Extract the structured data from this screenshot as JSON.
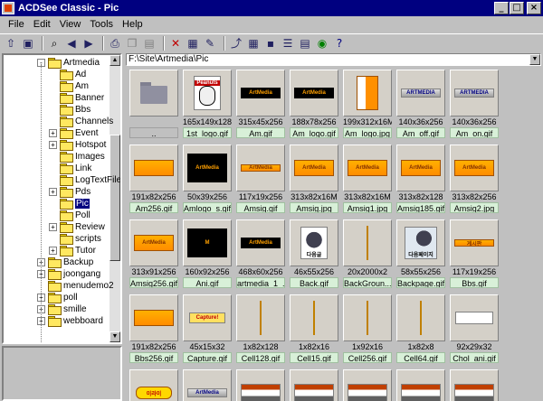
{
  "window": {
    "title": "ACDSee Classic - Pic"
  },
  "menu": [
    "File",
    "Edit",
    "View",
    "Tools",
    "Help"
  ],
  "menu_accel": [
    "F",
    "E",
    "V",
    "T",
    "H"
  ],
  "window_buttons": {
    "minimize": "_",
    "maximize": "□",
    "close": "×"
  },
  "toolbar_icons": [
    "browse-up-icon",
    "browse-folder-icon",
    "find-icon",
    "back-icon",
    "forward-icon",
    "print-icon",
    "copy-icon",
    "paste-icon",
    "delete-icon",
    "properties-icon",
    "edit-icon",
    "up-folder-icon",
    "view-large-icon",
    "view-small-icon",
    "view-list-icon",
    "view-details-icon",
    "slideshow-icon",
    "help-icon"
  ],
  "path": "F:\\Site\\Artmedia\\Pic",
  "tree": [
    {
      "label": "Artmedia",
      "level": 0,
      "expand": "-"
    },
    {
      "label": "Ad",
      "level": 1,
      "expand": ""
    },
    {
      "label": "Am",
      "level": 1,
      "expand": ""
    },
    {
      "label": "Banner",
      "level": 1,
      "expand": ""
    },
    {
      "label": "Bbs",
      "level": 1,
      "expand": ""
    },
    {
      "label": "Channels",
      "level": 1,
      "expand": ""
    },
    {
      "label": "Event",
      "level": 1,
      "expand": "+"
    },
    {
      "label": "Hotspot",
      "level": 1,
      "expand": "+"
    },
    {
      "label": "Images",
      "level": 1,
      "expand": ""
    },
    {
      "label": "Link",
      "level": 1,
      "expand": ""
    },
    {
      "label": "LogTextFile",
      "level": 1,
      "expand": ""
    },
    {
      "label": "Pds",
      "level": 1,
      "expand": "+"
    },
    {
      "label": "Pic",
      "level": 1,
      "expand": "",
      "selected": true
    },
    {
      "label": "Poll",
      "level": 1,
      "expand": ""
    },
    {
      "label": "Review",
      "level": 1,
      "expand": "+"
    },
    {
      "label": "scripts",
      "level": 1,
      "expand": ""
    },
    {
      "label": "Tutor",
      "level": 1,
      "expand": "+"
    },
    {
      "label": "Backup",
      "level": 0,
      "expand": "+"
    },
    {
      "label": "joongang",
      "level": 0,
      "expand": "+"
    },
    {
      "label": "menudemo2",
      "level": 0,
      "expand": ""
    },
    {
      "label": "poll",
      "level": 0,
      "expand": "+"
    },
    {
      "label": "smille",
      "level": 0,
      "expand": "+"
    },
    {
      "label": "webboard",
      "level": 0,
      "expand": "+"
    }
  ],
  "files": [
    {
      "dims": "",
      "name": "..",
      "kind": "folder"
    },
    {
      "dims": "165x149x128",
      "name": "1st_logo.gif",
      "kind": "peanuts",
      "text": "Peanuts"
    },
    {
      "dims": "315x45x256",
      "name": "Am.gif",
      "kind": "dark",
      "text": "ArtMedia"
    },
    {
      "dims": "188x78x256",
      "name": "Am_logo.gif",
      "kind": "dark",
      "text": "ArtMedia"
    },
    {
      "dims": "199x312x16M",
      "name": "Am_logo.jpg",
      "kind": "orange-tall",
      "text": ""
    },
    {
      "dims": "140x36x256",
      "name": "Am_off.gif",
      "kind": "silver",
      "text": "ARTMEDIA"
    },
    {
      "dims": "140x36x256",
      "name": "Am_on.gif",
      "kind": "silver",
      "text": "ARTMEDIA"
    },
    {
      "dims": "191x82x256",
      "name": "Am256.gif",
      "kind": "orange",
      "text": ""
    },
    {
      "dims": "50x39x256",
      "name": "Amlogo_s.gif",
      "kind": "dark-logo",
      "text": "ArtMedia"
    },
    {
      "dims": "117x19x256",
      "name": "Amsig.gif",
      "kind": "orange-slim",
      "text": "ArtMedia"
    },
    {
      "dims": "313x82x16M",
      "name": "Amsig.jpg",
      "kind": "orange",
      "text": "ArtMedia"
    },
    {
      "dims": "313x82x16M",
      "name": "Amsig1.jpg",
      "kind": "orange",
      "text": "ArtMedia"
    },
    {
      "dims": "313x82x128",
      "name": "Amsig185.gif",
      "kind": "orange",
      "text": "ArtMedia"
    },
    {
      "dims": "313x82x256",
      "name": "Amsig2.jpg",
      "kind": "orange",
      "text": "ArtMedia"
    },
    {
      "dims": "313x91x256",
      "name": "Amsig256.gif",
      "kind": "orange",
      "text": "ArtMedia"
    },
    {
      "dims": "160x92x256",
      "name": "Ani.gif",
      "kind": "dark-logo",
      "text": "M"
    },
    {
      "dims": "468x60x256",
      "name": "artmedia_1_...",
      "kind": "dark",
      "text": "ArtMedia"
    },
    {
      "dims": "46x55x256",
      "name": "Back.gif",
      "kind": "back",
      "text": "다음글"
    },
    {
      "dims": "20x2000x2",
      "name": "BackGroun...",
      "kind": "line",
      "text": ""
    },
    {
      "dims": "58x55x256",
      "name": "Backpage.gif",
      "kind": "backpage",
      "text": "다음페이지"
    },
    {
      "dims": "117x19x256",
      "name": "Bbs.gif",
      "kind": "orange-slim",
      "text": "게시판"
    },
    {
      "dims": "191x82x256",
      "name": "Bbs256.gif",
      "kind": "orange",
      "text": ""
    },
    {
      "dims": "45x15x32",
      "name": "Capture.gif",
      "kind": "capture",
      "text": "Capture!"
    },
    {
      "dims": "1x82x128",
      "name": "Cell128.gif",
      "kind": "line",
      "text": ""
    },
    {
      "dims": "1x82x16",
      "name": "Cell15.gif",
      "kind": "line",
      "text": ""
    },
    {
      "dims": "1x92x16",
      "name": "Cell256.gif",
      "kind": "line",
      "text": ""
    },
    {
      "dims": "1x82x8",
      "name": "Cell64.gif",
      "kind": "line",
      "text": ""
    },
    {
      "dims": "92x29x32",
      "name": "Chol_ani.gif",
      "kind": "white",
      "text": ""
    },
    {
      "dims": "",
      "name": "",
      "kind": "korean",
      "text": "이라이"
    },
    {
      "dims": "",
      "name": "",
      "kind": "silver",
      "text": "ArtMedia"
    },
    {
      "dims": "",
      "name": "",
      "kind": "mixed",
      "text": ""
    },
    {
      "dims": "",
      "name": "",
      "kind": "mixed",
      "text": ""
    },
    {
      "dims": "",
      "name": "",
      "kind": "mixed",
      "text": ""
    },
    {
      "dims": "",
      "name": "",
      "kind": "mixed",
      "text": ""
    },
    {
      "dims": "",
      "name": "",
      "kind": "mixed",
      "text": ""
    }
  ]
}
